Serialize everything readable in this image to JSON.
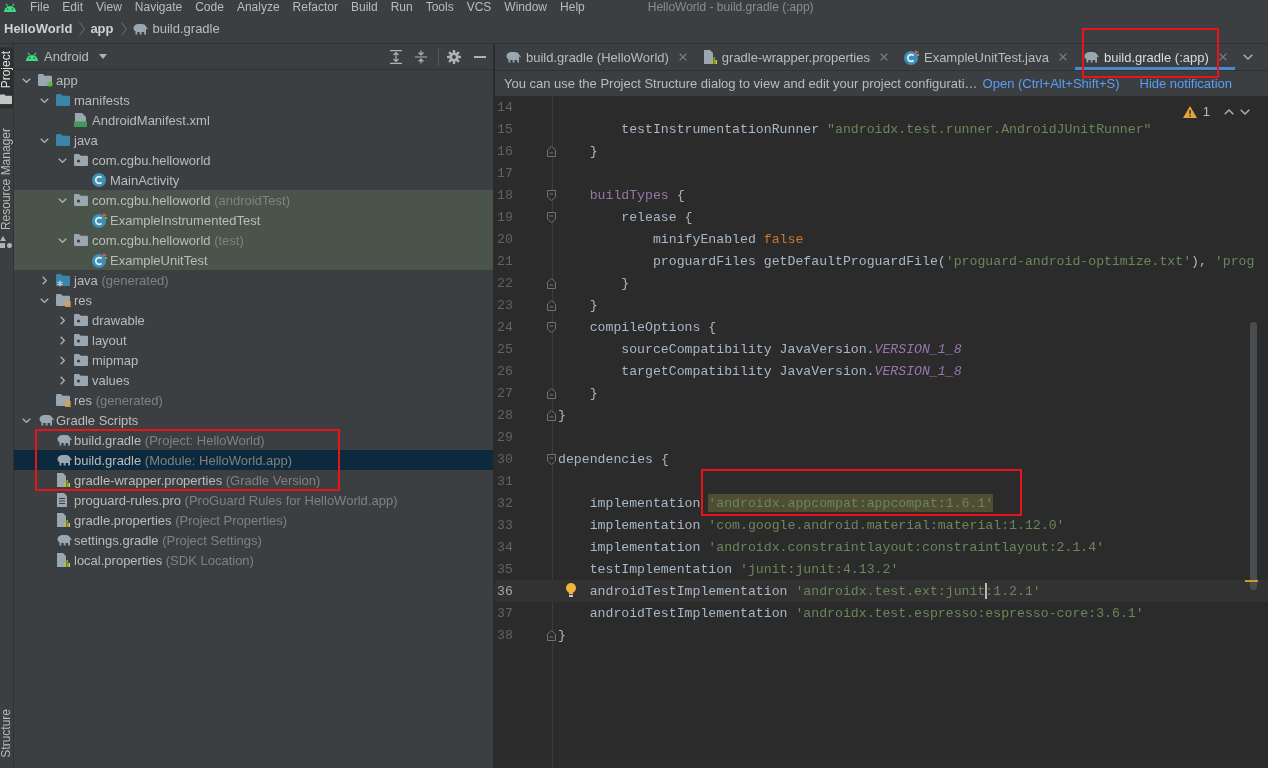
{
  "window": {
    "title": "HelloWorld - build.gradle (:app)"
  },
  "menu": [
    "File",
    "Edit",
    "View",
    "Navigate",
    "Code",
    "Analyze",
    "Refactor",
    "Build",
    "Run",
    "Tools",
    "VCS",
    "Window",
    "Help"
  ],
  "breadcrumbs": [
    {
      "label": "HelloWorld",
      "kind": "project"
    },
    {
      "label": "app",
      "kind": "module"
    },
    {
      "label": "build.gradle",
      "kind": "gradle"
    }
  ],
  "tool_strip": {
    "top": [
      {
        "label": "Project",
        "kind": "project",
        "selected": true
      },
      {
        "label": "Resource Manager",
        "kind": "resources",
        "selected": false
      }
    ],
    "bottom": [
      {
        "label": "Structure",
        "selected": false
      }
    ]
  },
  "project_panel": {
    "view": "Android",
    "tree": [
      {
        "label": "app",
        "kind": "module",
        "expanded": true,
        "selected": false,
        "children": [
          {
            "label": "manifests",
            "kind": "folder",
            "expanded": true,
            "selected": false,
            "children": [
              {
                "label": "AndroidManifest.xml",
                "kind": "manifest",
                "selected": false
              }
            ]
          },
          {
            "label": "java",
            "kind": "folder",
            "expanded": true,
            "selected": false,
            "children": [
              {
                "label": "com.cgbu.helloworld",
                "kind": "package",
                "expanded": true,
                "selected": false,
                "children": [
                  {
                    "label": "MainActivity",
                    "kind": "class",
                    "selected": false
                  }
                ]
              },
              {
                "label": "com.cgbu.helloworld",
                "note": "(androidTest)",
                "kind": "package",
                "test_scope": true,
                "expanded": true,
                "selected": false,
                "children": [
                  {
                    "label": "ExampleInstrumentedTest",
                    "kind": "test_class",
                    "selected": false
                  }
                ]
              },
              {
                "label": "com.cgbu.helloworld",
                "note": "(test)",
                "kind": "package",
                "test_scope": true,
                "expanded": true,
                "selected": false,
                "children": [
                  {
                    "label": "ExampleUnitTest",
                    "kind": "test_class",
                    "selected": false
                  }
                ]
              }
            ]
          },
          {
            "label": "java",
            "note": "(generated)",
            "kind": "generated_folder",
            "expanded": false,
            "selected": false
          },
          {
            "label": "res",
            "kind": "resource_folder",
            "expanded": true,
            "selected": false,
            "children": [
              {
                "label": "drawable",
                "kind": "package",
                "expanded": false,
                "selected": false
              },
              {
                "label": "layout",
                "kind": "package",
                "expanded": false,
                "selected": false
              },
              {
                "label": "mipmap",
                "kind": "package",
                "expanded": false,
                "selected": false
              },
              {
                "label": "values",
                "kind": "package",
                "expanded": false,
                "selected": false
              }
            ]
          },
          {
            "label": "res",
            "note": "(generated)",
            "kind": "resource_folder",
            "selected": false
          }
        ]
      },
      {
        "label": "Gradle Scripts",
        "kind": "gradle",
        "expanded": true,
        "selected": false,
        "children": [
          {
            "label": "build.gradle",
            "note": "(Project: HelloWorld)",
            "kind": "gradle",
            "selected": false
          },
          {
            "label": "build.gradle",
            "note": "(Module: HelloWorld.app)",
            "kind": "gradle",
            "selected": true,
            "annotation_frame": true
          },
          {
            "label": "gradle-wrapper.properties",
            "note": "(Gradle Version)",
            "kind": "properties",
            "selected": false
          },
          {
            "label": "proguard-rules.pro",
            "note": "(ProGuard Rules for HelloWorld.app)",
            "kind": "file",
            "selected": false
          },
          {
            "label": "gradle.properties",
            "note": "(Project Properties)",
            "kind": "properties",
            "selected": false
          },
          {
            "label": "settings.gradle",
            "note": "(Project Settings)",
            "kind": "gradle",
            "selected": false
          },
          {
            "label": "local.properties",
            "note": "(SDK Location)",
            "kind": "properties",
            "selected": false
          }
        ]
      }
    ]
  },
  "editor": {
    "tabs": [
      {
        "label": "build.gradle (HelloWorld)",
        "kind": "gradle",
        "selected": false
      },
      {
        "label": "gradle-wrapper.properties",
        "kind": "properties",
        "selected": false
      },
      {
        "label": "ExampleUnitTest.java",
        "kind": "test_class",
        "selected": false
      },
      {
        "label": "build.gradle (:app)",
        "kind": "gradle",
        "selected": true,
        "annotation_frame": true
      }
    ],
    "notification": {
      "text": "You can use the Project Structure dialog to view and edit your project configurati…",
      "actions": [
        "Open (Ctrl+Alt+Shift+S)",
        "Hide notification"
      ]
    },
    "inspection": {
      "warnings": "1"
    },
    "lines": [
      {
        "children": [
          {
            "children": [
              {
                "number": "14",
                "current": false
              },
              {
                "number": "15",
                "current": false,
                "parts": [
                  {
                    "text": "testInstrumentationRunner ",
                    "kind": "plain"
                  },
                  {
                    "text": "\"androidx.test.runner.AndroidJUnitRunner\"",
                    "kind": "string"
                  }
                ]
              }
            ]
          },
          {
            "number": "16",
            "current": false,
            "fold_end": true,
            "parts": [
              {
                "text": "}",
                "kind": "plain"
              }
            ]
          },
          {
            "number": "17",
            "current": false
          },
          {
            "number": "18",
            "current": false,
            "fold_start": true,
            "parts": [
              {
                "text": "buildTypes",
                "kind": "dsl"
              },
              {
                "text": " {",
                "kind": "plain"
              }
            ],
            "children": [
              {
                "number": "19",
                "current": false,
                "fold_start": true,
                "parts": [
                  {
                    "text": "release {",
                    "kind": "plain"
                  }
                ],
                "children": [
                  {
                    "number": "20",
                    "current": false,
                    "parts": [
                      {
                        "text": "minifyEnabled ",
                        "kind": "plain"
                      },
                      {
                        "text": "false",
                        "kind": "keyword"
                      }
                    ]
                  },
                  {
                    "number": "21",
                    "current": false,
                    "parts": [
                      {
                        "text": "proguardFiles getDefaultProguardFile(",
                        "kind": "plain"
                      },
                      {
                        "text": "'proguard-android-optimize.txt'",
                        "kind": "string"
                      },
                      {
                        "text": "), ",
                        "kind": "plain"
                      },
                      {
                        "text": "'prog",
                        "kind": "string"
                      }
                    ]
                  }
                ]
              },
              {
                "number": "22",
                "current": false,
                "fold_end": true,
                "parts": [
                  {
                    "text": "}",
                    "kind": "plain"
                  }
                ]
              }
            ]
          },
          {
            "number": "23",
            "current": false,
            "fold_end": true,
            "parts": [
              {
                "text": "}",
                "kind": "plain"
              }
            ]
          },
          {
            "number": "24",
            "current": false,
            "fold_start": true,
            "parts": [
              {
                "text": "compileOptions {",
                "kind": "plain"
              }
            ],
            "children": [
              {
                "number": "25",
                "current": false,
                "parts": [
                  {
                    "text": "sourceCompatibility JavaVersion.",
                    "kind": "plain"
                  },
                  {
                    "text": "VERSION_1_8",
                    "kind": "constant"
                  }
                ]
              },
              {
                "number": "26",
                "current": false,
                "parts": [
                  {
                    "text": "targetCompatibility JavaVersion.",
                    "kind": "plain"
                  },
                  {
                    "text": "VERSION_1_8",
                    "kind": "constant"
                  }
                ]
              }
            ]
          },
          {
            "number": "27",
            "current": false,
            "fold_end": true,
            "parts": [
              {
                "text": "}",
                "kind": "plain"
              }
            ]
          }
        ]
      },
      {
        "number": "28",
        "current": false,
        "fold_end": true,
        "parts": [
          {
            "text": "}",
            "kind": "plain"
          }
        ]
      },
      {
        "number": "29",
        "current": false
      },
      {
        "number": "30",
        "current": false,
        "fold_start": true,
        "parts": [
          {
            "text": "dependencies {",
            "kind": "plain"
          }
        ],
        "children": [
          {
            "number": "31",
            "current": false
          },
          {
            "number": "32",
            "current": false,
            "parts": [
              {
                "text": "implementation ",
                "kind": "plain"
              },
              {
                "text": "'androidx.appcompat:appcompat:1.6.1'",
                "kind": "string",
                "highlighted": true,
                "annotation_frame": true
              }
            ]
          },
          {
            "number": "33",
            "current": false,
            "parts": [
              {
                "text": "implementation ",
                "kind": "plain"
              },
              {
                "text": "'com.google.android.material:material:1.12.0'",
                "kind": "string"
              }
            ]
          },
          {
            "number": "34",
            "current": false,
            "parts": [
              {
                "text": "implementation ",
                "kind": "plain"
              },
              {
                "text": "'androidx.constraintlayout:constraintlayout:2.1.4'",
                "kind": "string"
              }
            ]
          },
          {
            "number": "35",
            "current": false,
            "parts": [
              {
                "text": "testImplementation ",
                "kind": "plain"
              },
              {
                "text": "'junit:junit:4.13.2'",
                "kind": "string"
              }
            ]
          },
          {
            "number": "36",
            "current": true,
            "parts": [
              {
                "text": "androidTestImplementation ",
                "kind": "plain"
              },
              {
                "text": "'androidx.test.ext:junit",
                "kind": "string",
                "caret_after": true
              },
              {
                "text": ":1.2.1'",
                "kind": "string"
              }
            ]
          },
          {
            "number": "37",
            "current": false,
            "parts": [
              {
                "text": "androidTestImplementation ",
                "kind": "plain"
              },
              {
                "text": "'androidx.test.espresso:espresso-core:3.6.1'",
                "kind": "string"
              }
            ]
          }
        ]
      },
      {
        "number": "38",
        "current": false,
        "fold_end": true,
        "parts": [
          {
            "text": "}",
            "kind": "plain"
          }
        ]
      }
    ]
  }
}
